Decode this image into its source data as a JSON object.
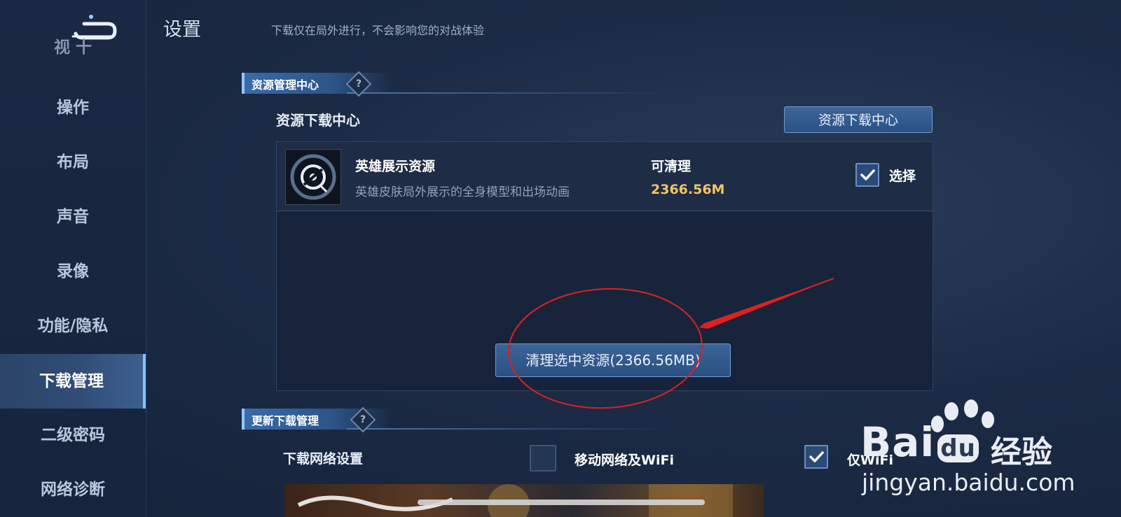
{
  "header": {
    "title": "设置",
    "subtitle": "下载仅在局外进行，不会影响您的对战体验"
  },
  "sidebar": {
    "items": [
      {
        "label": "视 十"
      },
      {
        "label": "操作"
      },
      {
        "label": "布局"
      },
      {
        "label": "声音"
      },
      {
        "label": "录像"
      },
      {
        "label": "功能/隐私"
      },
      {
        "label": "下载管理"
      },
      {
        "label": "二级密码"
      },
      {
        "label": "网络诊断"
      }
    ],
    "active_index": 6
  },
  "resource_section": {
    "header": "资源管理中心",
    "help_symbol": "?",
    "center_label": "资源下载中心",
    "center_button": "资源下载中心",
    "item": {
      "name": "英雄展示资源",
      "description": "英雄皮肤局外展示的全身模型和出场动画",
      "status": "可清理",
      "size": "2366.56M",
      "select_label": "选择",
      "selected": true
    },
    "clean_button": "清理选中资源(2366.56MB)"
  },
  "update_section": {
    "header": "更新下载管理",
    "help_symbol": "?",
    "network_label": "下载网络设置",
    "options": [
      {
        "label": "移动网络及WiFi",
        "checked": false
      },
      {
        "label": "仅WiFi",
        "checked": true
      }
    ]
  },
  "watermark": {
    "brand": "Bai",
    "brand_suffix": "du",
    "cn": "经验",
    "url": "jingyan.baidu.com"
  },
  "colors": {
    "accent": "#7fc4ff",
    "size_highlight": "#f2c463",
    "annotation": "#e02020"
  }
}
